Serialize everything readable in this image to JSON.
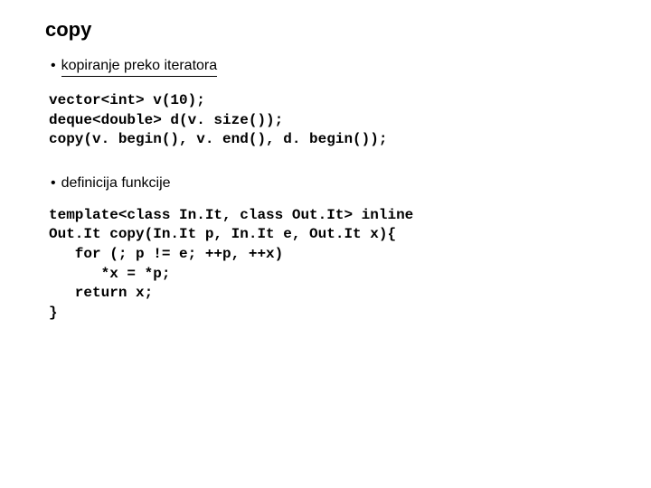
{
  "title": "copy",
  "bullets": {
    "b1": "kopiranje preko iteratora",
    "b2": "definicija funkcije"
  },
  "code": {
    "block1": "vector<int> v(10);\ndeque<double> d(v. size());\ncopy(v. begin(), v. end(), d. begin());",
    "block2": "template<class In.It, class Out.It> inline\nOut.It copy(In.It p, In.It e, Out.It x){\n   for (; p != e; ++p, ++x)\n      *x = *p;\n   return x;\n}"
  }
}
